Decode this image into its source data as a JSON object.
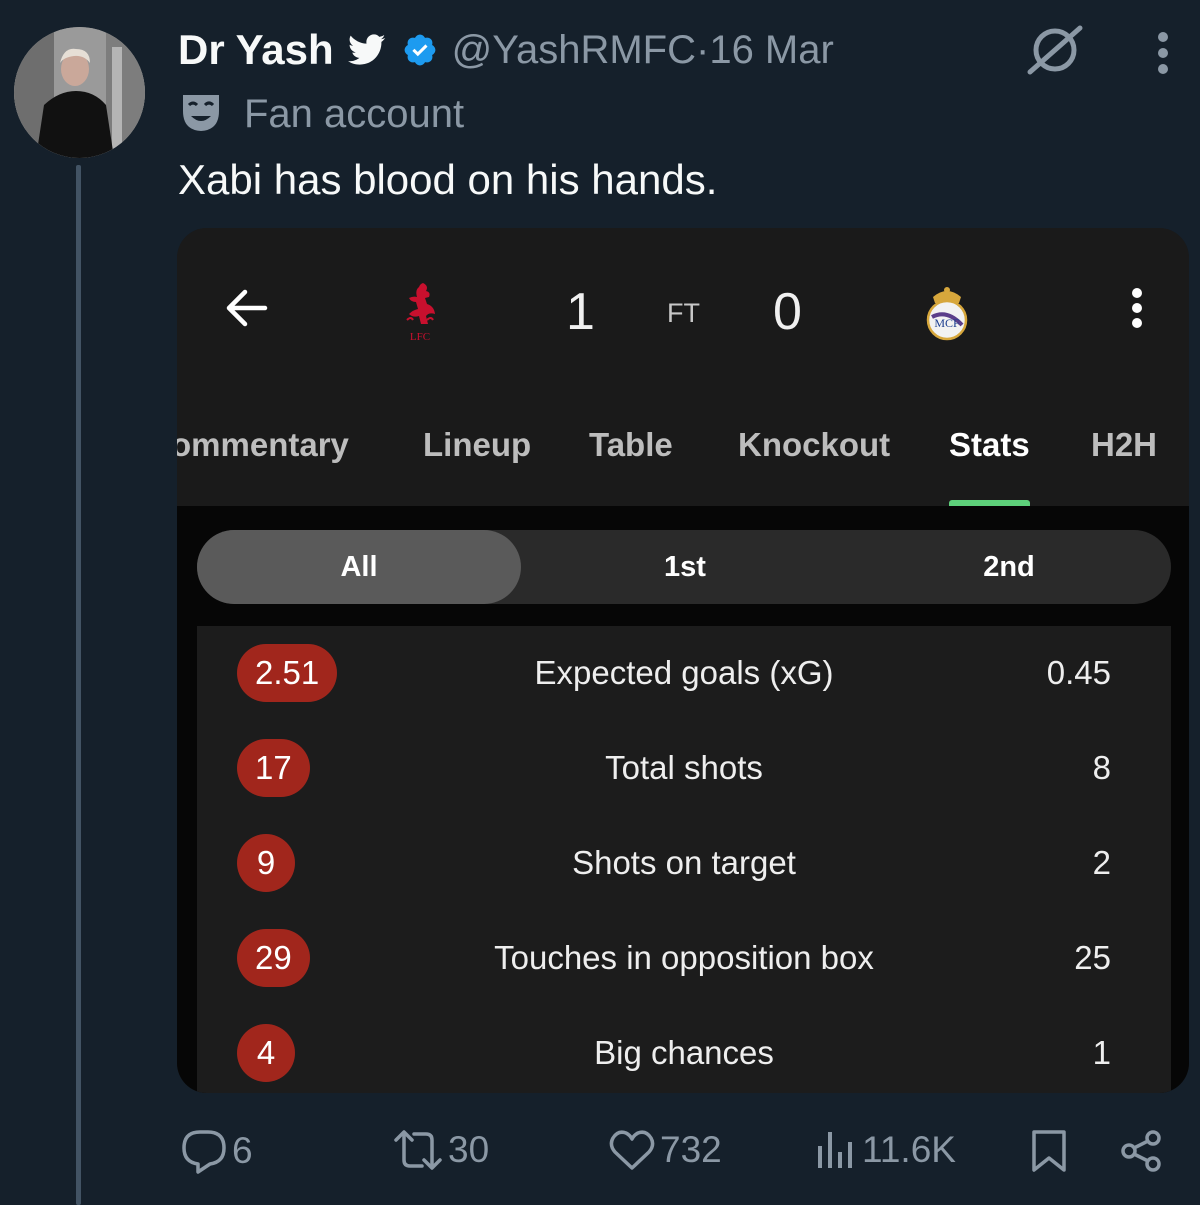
{
  "tweet": {
    "author_name": "Dr Yash",
    "handle": "@YashRMFC",
    "date_sep": " · ",
    "date": "16 Mar",
    "label": "Fan account",
    "text": "Xabi has blood on his hands."
  },
  "match": {
    "home_score": "1",
    "status": "FT",
    "away_score": "0",
    "home_crest_text": "LFC"
  },
  "tabs": [
    "ommentary",
    "Lineup",
    "Table",
    "Knockout",
    "Stats",
    "H2H"
  ],
  "active_tab": "Stats",
  "periods": [
    "All",
    "1st",
    "2nd"
  ],
  "active_period": "All",
  "stats": [
    {
      "home": "2.51",
      "name": "Expected goals (xG)",
      "away": "0.45"
    },
    {
      "home": "17",
      "name": "Total shots",
      "away": "8"
    },
    {
      "home": "9",
      "name": "Shots on target",
      "away": "2"
    },
    {
      "home": "29",
      "name": "Touches in opposition box",
      "away": "25"
    },
    {
      "home": "4",
      "name": "Big chances",
      "away": "1"
    }
  ],
  "engagement": {
    "replies": "6",
    "reposts": "30",
    "likes": "732",
    "views": "11.6K"
  },
  "colors": {
    "background": "#15202b",
    "secondary_text": "#8b98a5",
    "verified": "#1d9bf0",
    "stat_pill": "#a1261c",
    "tab_indicator": "#5dd07a"
  },
  "icons": [
    "bird-icon",
    "verified-icon",
    "grok-icon",
    "more-icon",
    "fan-mask-icon",
    "back-arrow-icon",
    "liverpool-crest-icon",
    "real-madrid-crest-icon",
    "kebab-icon",
    "reply-icon",
    "repost-icon",
    "like-icon",
    "views-icon",
    "bookmark-icon",
    "share-icon"
  ]
}
